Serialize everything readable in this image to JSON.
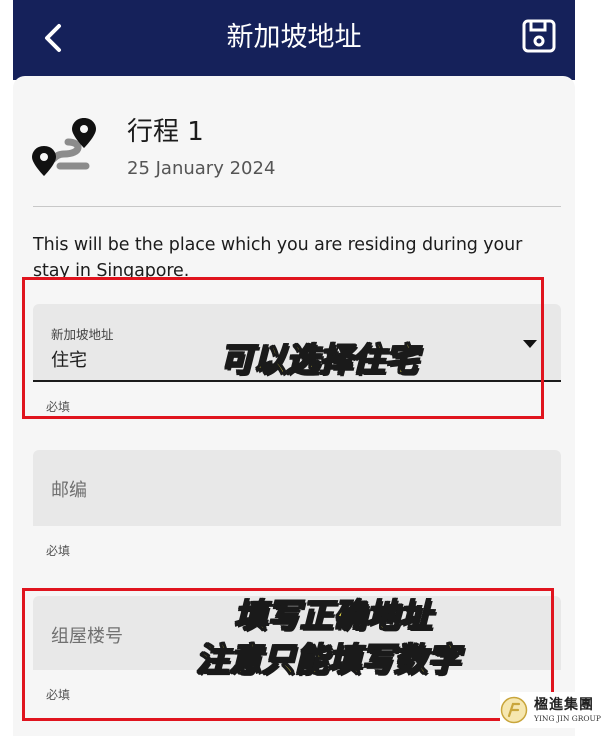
{
  "header": {
    "title": "新加坡地址",
    "back_icon": "chevron-left-icon",
    "save_icon": "save-icon"
  },
  "trip": {
    "title": "行程 1",
    "date": "25 January 2024",
    "icon": "route-pin-icon"
  },
  "info_text": "This will be the place which you are residing during your stay in Singapore.",
  "fields": {
    "address_type": {
      "label": "新加坡地址",
      "value": "住宅",
      "helper": "必填"
    },
    "postal_code": {
      "placeholder": "邮编",
      "helper": "必填"
    },
    "block_number": {
      "placeholder": "组屋楼号",
      "helper": "必填"
    }
  },
  "annotations": {
    "select_residence": "可以选择住宅",
    "fill_address_line1": "填写正确地址",
    "fill_address_line2": "注意只能填写数字"
  },
  "watermark": {
    "cn": "楹進集團",
    "en": "YING JIN GROUP"
  },
  "colors": {
    "header_bg": "#15215a",
    "annotation_box": "#e0141e",
    "annotation_text": "#f7e94b"
  }
}
